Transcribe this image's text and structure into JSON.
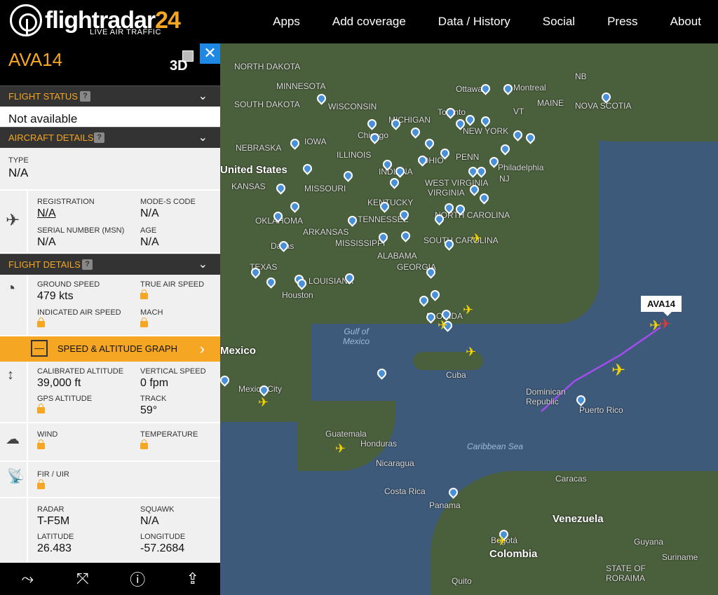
{
  "header": {
    "logo_name": "flightradar",
    "logo_num": "24",
    "tagline": "LIVE AIR TRAFFIC",
    "nav": [
      "Apps",
      "Add coverage",
      "Data / History",
      "Social",
      "Press",
      "About"
    ]
  },
  "panel": {
    "callsign": "AVA14",
    "btn_3d": "3D",
    "flight_status": {
      "title": "FLIGHT STATUS",
      "value": "Not available"
    },
    "aircraft_details": {
      "title": "AIRCRAFT DETAILS",
      "type_label": "TYPE",
      "type_value": "N/A",
      "registration_label": "REGISTRATION",
      "registration_value": "N/A",
      "modes_label": "MODE-S CODE",
      "modes_value": "N/A",
      "serial_label": "SERIAL NUMBER (MSN)",
      "serial_value": "N/A",
      "age_label": "AGE",
      "age_value": "N/A"
    },
    "flight_details": {
      "title": "FLIGHT DETAILS",
      "ground_speed_label": "GROUND SPEED",
      "ground_speed_value": "479 kts",
      "true_air_speed_label": "TRUE AIR SPEED",
      "ias_label": "INDICATED AIR SPEED",
      "mach_label": "MACH",
      "graph_label": "SPEED & ALTITUDE GRAPH",
      "cal_alt_label": "CALIBRATED ALTITUDE",
      "cal_alt_value": "39,000 ft",
      "vs_label": "VERTICAL SPEED",
      "vs_value": "0 fpm",
      "gps_alt_label": "GPS ALTITUDE",
      "track_label": "TRACK",
      "track_value": "59°",
      "wind_label": "WIND",
      "temp_label": "TEMPERATURE",
      "fir_label": "FIR / UIR",
      "radar_label": "RADAR",
      "radar_value": "T-F5M",
      "squawk_label": "SQUAWK",
      "squawk_value": "N/A",
      "lat_label": "LATITUDE",
      "lat_value": "26.483",
      "lon_label": "LONGITUDE",
      "lon_value": "-57.2684"
    }
  },
  "map": {
    "selected_flight_tag": "AVA14",
    "labels": {
      "north_dakota": "NORTH DAKOTA",
      "minnesota": "MINNESOTA",
      "south_dakota": "SOUTH DAKOTA",
      "wisconsin": "WISCONSIN",
      "michigan": "MICHIGAN",
      "ottawa": "Ottawa",
      "montreal": "Montreal",
      "maine": "MAINE",
      "nova_scotia": "NOVA SCOTIA",
      "nb": "NB",
      "vt": "VT",
      "nebraska": "NEBRASKA",
      "iowa": "IOWA",
      "chicago": "Chicago",
      "toronto": "Toronto",
      "new_york": "NEW YORK",
      "united_states": "United States",
      "illinois": "ILLINOIS",
      "indiana": "INDIANA",
      "ohio": "OHIO",
      "penn": "PENN",
      "philadelphia": "Philadelphia",
      "nj": "NJ",
      "kansas": "KANSAS",
      "missouri": "MISSOURI",
      "west_virginia": "WEST VIRGINIA",
      "virginia": "VIRGINIA",
      "kentucky": "KENTUCKY",
      "oklahoma": "OKLAHOMA",
      "arkansas": "ARKANSAS",
      "tennessee": "TENNESSEE",
      "north_carolina": "NORTH CAROLINA",
      "dallas": "Dallas",
      "mississippi": "MISSISSIPPI",
      "alabama": "ALABAMA",
      "south_carolina": "SOUTH CAROLINA",
      "georgia": "GEORGIA",
      "texas": "TEXAS",
      "louisiana": "LOUISIANA",
      "houston": "Houston",
      "florida": "FLORIDA",
      "gulf_of_mexico": "Gulf of Mexico",
      "mexico": "Mexico",
      "cuba": "Cuba",
      "mexico_city": "Mexico City",
      "dominican_republic": "Dominican Republic",
      "puerto_rico": "Puerto Rico",
      "guatemala": "Guatemala",
      "honduras": "Honduras",
      "caribbean_sea": "Caribbean Sea",
      "nicaragua": "Nicaragua",
      "caracas": "Caracas",
      "costa_rica": "Costa Rica",
      "panama": "Panama",
      "venezuela": "Venezuela",
      "guyana": "Guyana",
      "bogota": "Bogotá",
      "colombia": "Colombia",
      "suriname": "Suriname",
      "quito": "Quito",
      "state_of_roraima": "STATE OF RORAIMA"
    }
  },
  "bottom": {
    "route_icon": "route-icon",
    "fit_icon": "fit-view-icon",
    "alert_icon": "alert-icon",
    "share_icon": "share-icon"
  }
}
